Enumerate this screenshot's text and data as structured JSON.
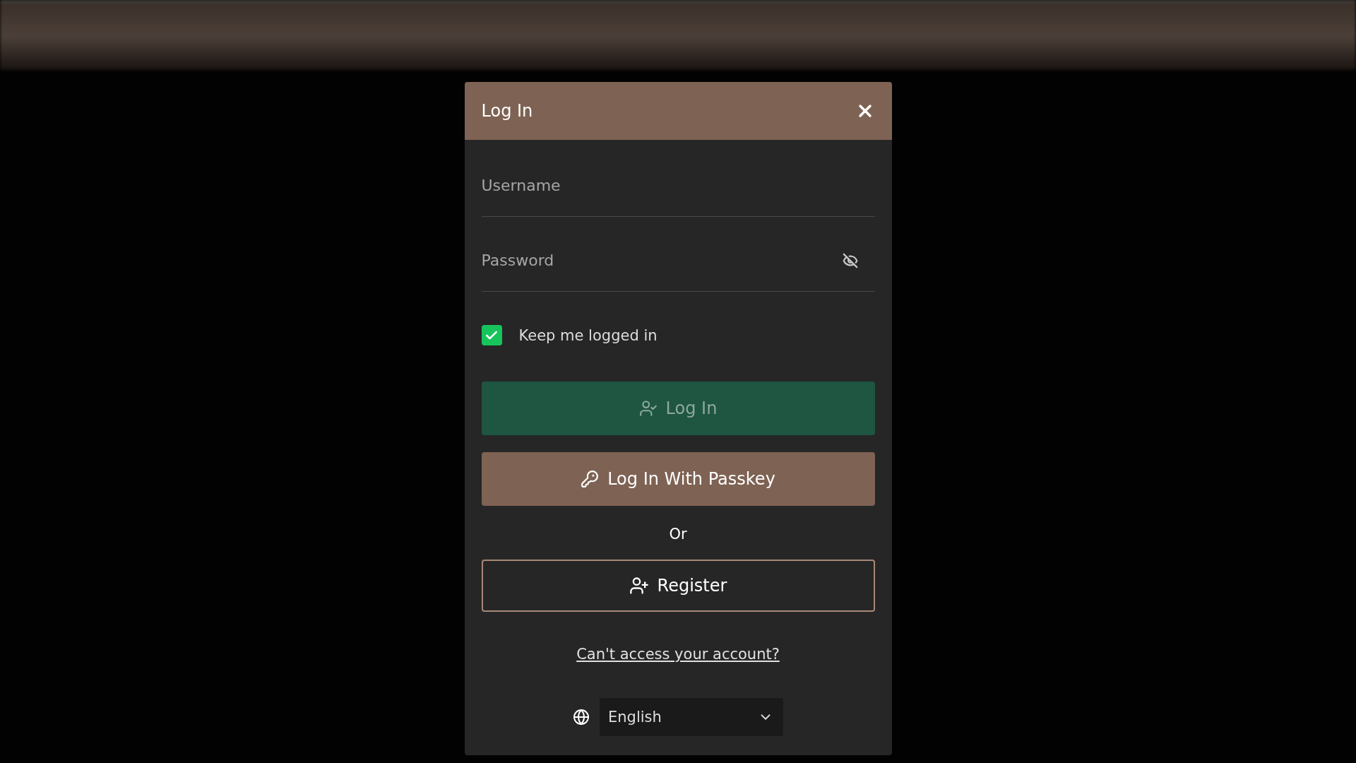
{
  "dialog": {
    "title": "Log In"
  },
  "fields": [
    {
      "kind": "text",
      "placeholder": "Username"
    },
    {
      "kind": "password",
      "placeholder": "Password"
    }
  ],
  "keep_logged_in": {
    "label": "Keep me logged in",
    "checked": true
  },
  "buttons": [
    {
      "kind": "primary",
      "label": "Log In",
      "disabled": true
    },
    {
      "kind": "passkey",
      "label": "Log In With Passkey",
      "disabled": false
    }
  ],
  "separator": "Or",
  "register_button": {
    "label": "Register"
  },
  "help_link": "Can't access your account?",
  "language": {
    "value": "English"
  }
}
